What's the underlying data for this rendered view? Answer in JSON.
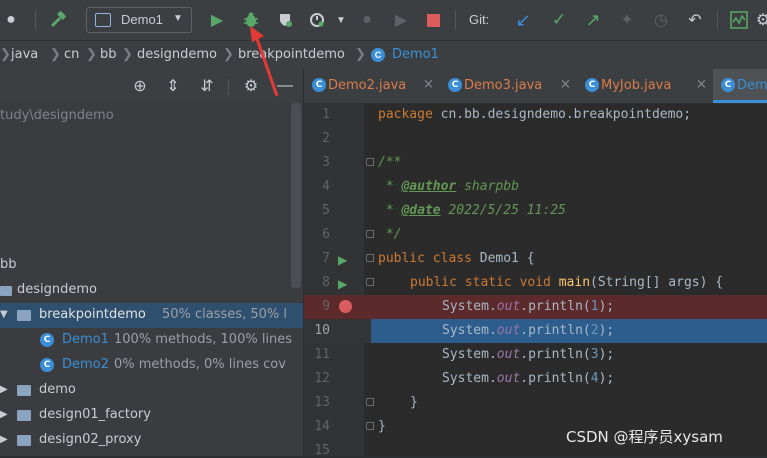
{
  "toolbar": {
    "run_config": "Demo1",
    "git_label": "Git:"
  },
  "breadcrumb": [
    "java",
    "cn",
    "bb",
    "designdemo",
    "breakpointdemo",
    "Demo1"
  ],
  "project": {
    "path": "tudy\\designdemo",
    "rows": [
      {
        "label": "bb",
        "extra": ""
      },
      {
        "label": "designdemo",
        "extra": ""
      },
      {
        "label": "breakpointdemo",
        "extra": "50% classes, 50% l"
      },
      {
        "label": "Demo1",
        "extra": "100% methods, 100% lines"
      },
      {
        "label": "Demo2",
        "extra": "0% methods, 0% lines cov"
      },
      {
        "label": "demo",
        "extra": ""
      },
      {
        "label": "design01_factory",
        "extra": ""
      },
      {
        "label": "design02_proxy",
        "extra": ""
      }
    ]
  },
  "tabs": [
    {
      "label": "Demo2.java",
      "close": "×"
    },
    {
      "label": "Demo3.java",
      "close": "×"
    },
    {
      "label": "MyJob.java",
      "close": "×"
    },
    {
      "label": "Dem",
      "close": ""
    }
  ],
  "editor": {
    "line_numbers": [
      "1",
      "2",
      "3",
      "4",
      "5",
      "6",
      "7",
      "8",
      "9",
      "10",
      "11",
      "12",
      "13",
      "14",
      "15"
    ],
    "line1_kw": "package",
    "line1_rest": " cn.bb.designdemo.breakpointdemo;",
    "line3": "/**",
    "line4_pre": " * ",
    "line4_tag": "@author",
    "line4_rest": " sharpbb",
    "line5_pre": " * ",
    "line5_tag": "@date",
    "line5_rest": " 2022/5/25 11:25",
    "line6": " */",
    "line7_kw": "public class",
    "line7_rest": " Demo1 {",
    "line8_kw": "public static void",
    "line8_fn": "main",
    "line8_rest": "(String[] args) {",
    "println_lines": [
      {
        "pre": "System.",
        "field": "out",
        "mid": ".println(",
        "num": "1",
        "post": ");"
      },
      {
        "pre": "System.",
        "field": "out",
        "mid": ".println(",
        "num": "2",
        "post": ");"
      },
      {
        "pre": "System.",
        "field": "out",
        "mid": ".println(",
        "num": "3",
        "post": ");"
      },
      {
        "pre": "System.",
        "field": "out",
        "mid": ".println(",
        "num": "4",
        "post": ");"
      }
    ],
    "line13": "}",
    "line14": "}"
  },
  "watermark": "CSDN @程序员xysam",
  "colors": {
    "breakpoint_line": "#5c2a2b",
    "current_line": "#2d5d8c",
    "accent_blue": "#3a8fd6",
    "arrow_red": "#e53935"
  }
}
